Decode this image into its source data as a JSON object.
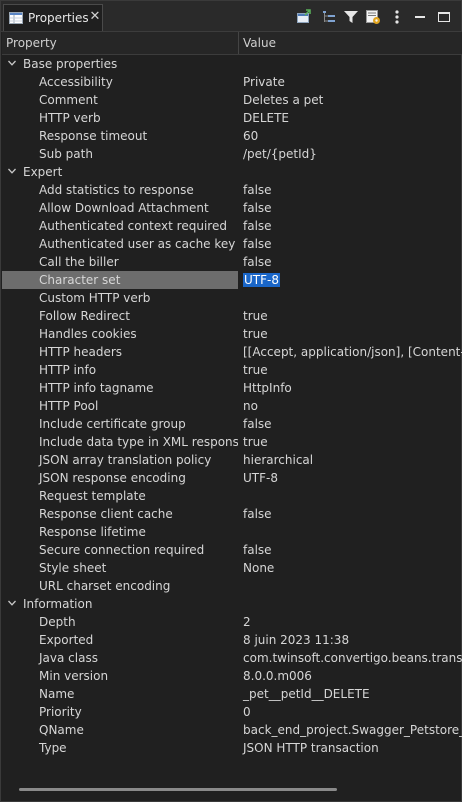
{
  "tab": {
    "title": "Properties",
    "close_glyph": "✕"
  },
  "toolbar": {
    "icons": [
      "new-window-icon",
      "tree-icon",
      "filter-icon",
      "show-advanced-icon",
      "view-menu-icon",
      "minimize-icon",
      "maximize-icon"
    ]
  },
  "columns": {
    "property": "Property",
    "value": "Value"
  },
  "rows": [
    {
      "kind": "category",
      "name": "Base properties"
    },
    {
      "kind": "prop",
      "name": "Accessibility",
      "value": "Private"
    },
    {
      "kind": "prop",
      "name": "Comment",
      "value": "Deletes a pet"
    },
    {
      "kind": "prop",
      "name": "HTTP verb",
      "value": "DELETE"
    },
    {
      "kind": "prop",
      "name": "Response timeout",
      "value": "60"
    },
    {
      "kind": "prop",
      "name": "Sub path",
      "value": "/pet/{petId}"
    },
    {
      "kind": "category",
      "name": "Expert"
    },
    {
      "kind": "prop",
      "name": "Add statistics to response",
      "value": "false"
    },
    {
      "kind": "prop",
      "name": "Allow Download Attachment",
      "value": "false"
    },
    {
      "kind": "prop",
      "name": "Authenticated context required",
      "value": "false"
    },
    {
      "kind": "prop",
      "name": "Authenticated user as cache key",
      "value": "false"
    },
    {
      "kind": "prop",
      "name": "Call the biller",
      "value": "false"
    },
    {
      "kind": "prop",
      "name": "Character set",
      "value": "UTF-8",
      "selected": true
    },
    {
      "kind": "prop",
      "name": "Custom HTTP verb",
      "value": ""
    },
    {
      "kind": "prop",
      "name": "Follow Redirect",
      "value": "true"
    },
    {
      "kind": "prop",
      "name": "Handles cookies",
      "value": "true"
    },
    {
      "kind": "prop",
      "name": "HTTP headers",
      "value": "[[Accept, application/json], [Content-Typ"
    },
    {
      "kind": "prop",
      "name": "HTTP info",
      "value": "true"
    },
    {
      "kind": "prop",
      "name": "HTTP info tagname",
      "value": "HttpInfo"
    },
    {
      "kind": "prop",
      "name": "HTTP Pool",
      "value": "no"
    },
    {
      "kind": "prop",
      "name": "Include certificate group",
      "value": "false"
    },
    {
      "kind": "prop",
      "name": "Include data type in XML response no",
      "value": "true"
    },
    {
      "kind": "prop",
      "name": "JSON array translation policy",
      "value": "hierarchical"
    },
    {
      "kind": "prop",
      "name": "JSON response encoding",
      "value": "UTF-8"
    },
    {
      "kind": "prop",
      "name": "Request template",
      "value": ""
    },
    {
      "kind": "prop",
      "name": "Response client cache",
      "value": "false"
    },
    {
      "kind": "prop",
      "name": "Response lifetime",
      "value": ""
    },
    {
      "kind": "prop",
      "name": "Secure connection required",
      "value": "false"
    },
    {
      "kind": "prop",
      "name": "Style sheet",
      "value": "None"
    },
    {
      "kind": "prop",
      "name": "URL charset encoding",
      "value": ""
    },
    {
      "kind": "category",
      "name": "Information"
    },
    {
      "kind": "prop",
      "name": "Depth",
      "value": "2"
    },
    {
      "kind": "prop",
      "name": "Exported",
      "value": "8 juin 2023 11:38"
    },
    {
      "kind": "prop",
      "name": "Java class",
      "value": "com.twinsoft.convertigo.beans.transactio"
    },
    {
      "kind": "prop",
      "name": "Min version",
      "value": "8.0.0.m006"
    },
    {
      "kind": "prop",
      "name": "Name",
      "value": "_pet__petId__DELETE"
    },
    {
      "kind": "prop",
      "name": "Priority",
      "value": "0"
    },
    {
      "kind": "prop",
      "name": "QName",
      "value": "back_end_project.Swagger_Petstore___Op"
    },
    {
      "kind": "prop",
      "name": "Type",
      "value": "JSON HTTP transaction"
    }
  ],
  "colors": {
    "selection_value": "#1a66c8",
    "selection_name": "#6d6d6d"
  }
}
